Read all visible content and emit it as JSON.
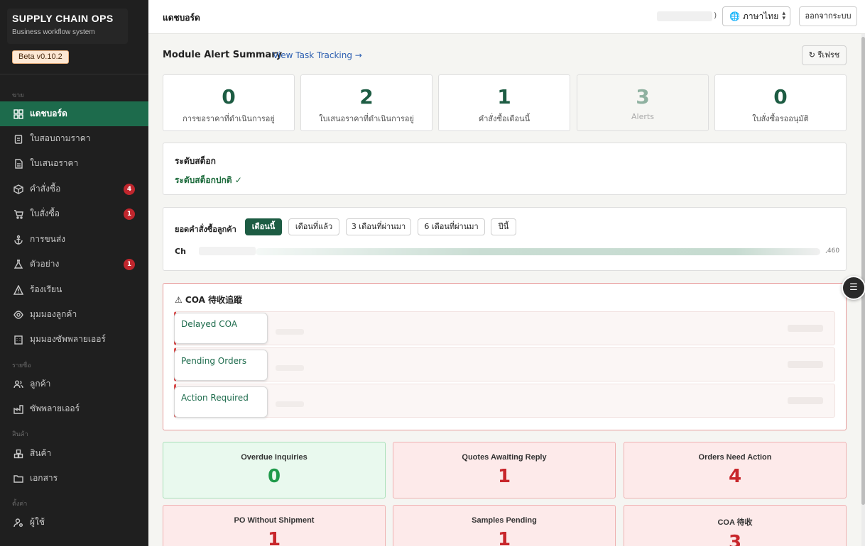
{
  "brand": {
    "title": "SUPPLY CHAIN OPS",
    "subtitle": "Business workflow system",
    "version": "Beta v0.10.2"
  },
  "sidebar": {
    "sections": [
      "ขาย",
      "รายชื่อ",
      "สินค้า",
      "ตั้งค่า"
    ],
    "items": [
      {
        "label": "แดชบอร์ด",
        "icon": "dashboard-icon",
        "active": true
      },
      {
        "label": "ใบสอบถามราคา",
        "icon": "clipboard-icon"
      },
      {
        "label": "ใบเสนอราคา",
        "icon": "document-icon"
      },
      {
        "label": "คำสั่งซื้อ",
        "icon": "box-icon",
        "badge": "4"
      },
      {
        "label": "ใบสั่งซื้อ",
        "icon": "cart-icon",
        "badge": "1"
      },
      {
        "label": "การขนส่ง",
        "icon": "anchor-icon"
      },
      {
        "label": "ตัวอย่าง",
        "icon": "flask-icon",
        "badge": "1"
      },
      {
        "label": "ร้องเรียน",
        "icon": "warning-icon"
      },
      {
        "label": "มุมมองลูกค้า",
        "icon": "eye-icon"
      },
      {
        "label": "มุมมองซัพพลายเออร์",
        "icon": "building-icon"
      },
      {
        "label": "ลูกค้า",
        "icon": "users-icon"
      },
      {
        "label": "ซัพพลายเออร์",
        "icon": "factory-icon"
      },
      {
        "label": "สินค้า",
        "icon": "boxes-icon"
      },
      {
        "label": "เอกสาร",
        "icon": "folder-icon"
      },
      {
        "label": "ผู้ใช้",
        "icon": "user-gear-icon"
      }
    ]
  },
  "header": {
    "title": "แดชบอร์ด",
    "user_suffix": ")",
    "language": "ภาษาไทย",
    "logout": "ออกจากระบบ"
  },
  "alerts": {
    "title": "Module Alert Summary",
    "link": "View Task Tracking →",
    "refresh": "↻ รีเฟรช",
    "cards": [
      {
        "value": "0",
        "label": "การขอราคาที่ดำเนินการอยู่"
      },
      {
        "value": "2",
        "label": "ใบเสนอราคาที่ดำเนินการอยู่"
      },
      {
        "value": "1",
        "label": "คำสั่งซื้อเดือนนี้"
      },
      {
        "value": "3",
        "label": "Alerts"
      },
      {
        "value": "0",
        "label": "ใบสั่งซื้อรออนุมัติ"
      }
    ]
  },
  "stock": {
    "title": "ระดับสต็อก",
    "status": "ระดับสต็อกปกติ ✓"
  },
  "customer_orders": {
    "title": "ยอดคำสั่งซื้อลูกค้า",
    "ranges": [
      "เดือนนี้",
      "เดือนที่แล้ว",
      "3 เดือนที่ผ่านมา",
      "6 เดือนที่ผ่านมา",
      "ปีนี้"
    ],
    "active_range": "เดือนนี้",
    "row_label": "Ch",
    "row_value": ",460"
  },
  "coa": {
    "title": "⚠ COA 待收追蹤",
    "tooltips": [
      "Delayed COA",
      "Pending Orders",
      "Action Required"
    ]
  },
  "kpis": [
    {
      "label": "Overdue Inquiries",
      "value": "0",
      "status": "good"
    },
    {
      "label": "Quotes Awaiting Reply",
      "value": "1",
      "status": "alert"
    },
    {
      "label": "Orders Need Action",
      "value": "4",
      "status": "alert"
    },
    {
      "label": "PO Without Shipment",
      "value": "1",
      "status": "alert"
    },
    {
      "label": "Samples Pending",
      "value": "1",
      "status": "alert"
    },
    {
      "label": "COA 待收",
      "value": "3",
      "status": "alert"
    }
  ],
  "colors": {
    "accent": "#1d6b4c",
    "sidebar_bg": "#1f1f1f",
    "alert_red": "#c8262b",
    "good_green": "#1f9a4a"
  }
}
